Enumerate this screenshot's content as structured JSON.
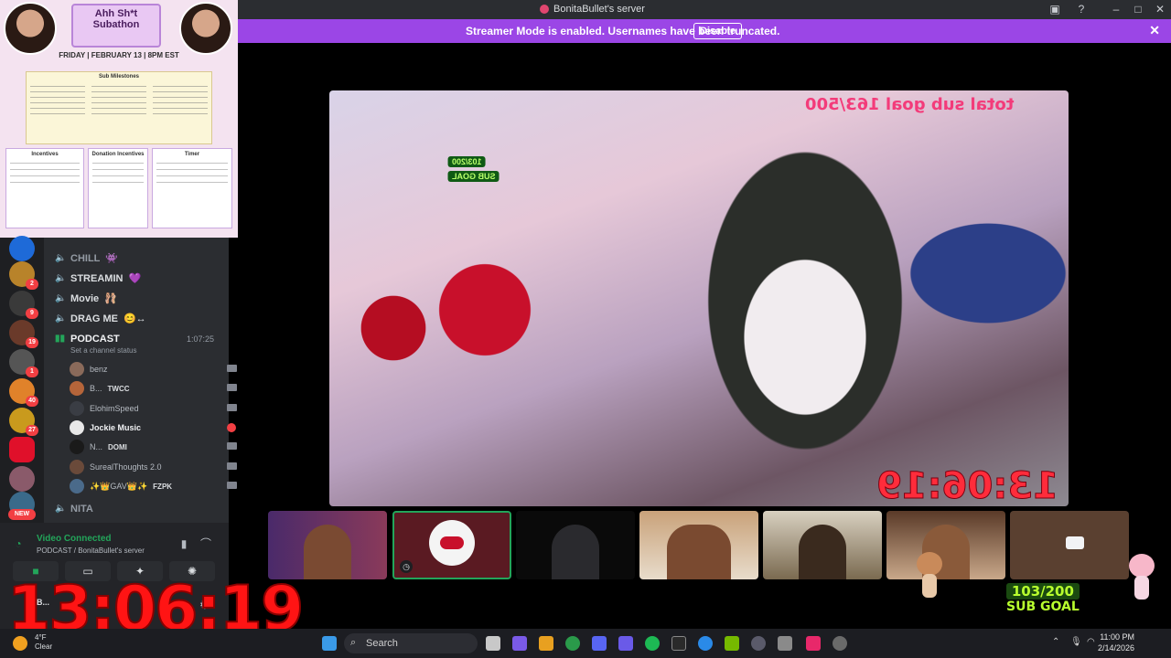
{
  "window": {
    "title": "BonitaBullet's server",
    "icons": [
      "inbox-icon",
      "help-icon",
      "minimize-icon",
      "maximize-icon",
      "close-icon"
    ]
  },
  "banner": {
    "message": "Streamer Mode is enabled. Usernames have been truncated.",
    "button": "Disable",
    "color": "#9b46e6"
  },
  "poster": {
    "headline": "Ahh Sh*t Subathon",
    "date": "FRIDAY | FEBRUARY 13 | 8PM EST",
    "milestones_title": "Sub Milestones",
    "boxes": [
      "Incentives",
      "Donation Incentives",
      "Timer"
    ]
  },
  "servers": {
    "badges": [
      "2",
      "9",
      "19",
      "1",
      "40",
      "27"
    ],
    "new_label": "NEW"
  },
  "channels": [
    {
      "name": "CHILL",
      "emoji": "👾"
    },
    {
      "name": "STREAMIN",
      "emoji": "💜"
    },
    {
      "name": "Movie",
      "emoji": "🩰"
    },
    {
      "name": "DRAG ME",
      "emoji": "😊↔"
    },
    {
      "name": "PODCAST",
      "emoji": ""
    },
    {
      "name": "NITA",
      "emoji": ""
    }
  ],
  "podcast": {
    "timer": "1:07:25",
    "status_prompt": "Set a channel status"
  },
  "members": [
    {
      "name": "benz",
      "tag": ""
    },
    {
      "name": "B...",
      "tag": "TWCC"
    },
    {
      "name": "ElohimSpeed",
      "tag": ""
    },
    {
      "name": "Jockie Music",
      "tag": ""
    },
    {
      "name": "N...",
      "tag": "DOMI"
    },
    {
      "name": "SurealThoughts 2.0",
      "tag": ""
    },
    {
      "name": "✨👑GAV👑✨",
      "tag": "FZPK"
    }
  ],
  "voice": {
    "status": "Video Connected",
    "location": "PODCAST / BonitaBullet's server"
  },
  "overlay": {
    "timer": "13:06:19",
    "user_initial": "B..."
  },
  "stream": {
    "goal_text": "total sub goal 163/500",
    "pill_1": "103/200",
    "pill_2": "SUB GOAL",
    "mirror_timer": "13:06:19"
  },
  "subgoal": {
    "count": "103/200",
    "label": "SUB GOAL"
  },
  "taskbar": {
    "weather_temp": "4°F",
    "weather_desc": "Clear",
    "search_placeholder": "Search",
    "time": "11:00 PM",
    "date": "2/14/2026"
  }
}
